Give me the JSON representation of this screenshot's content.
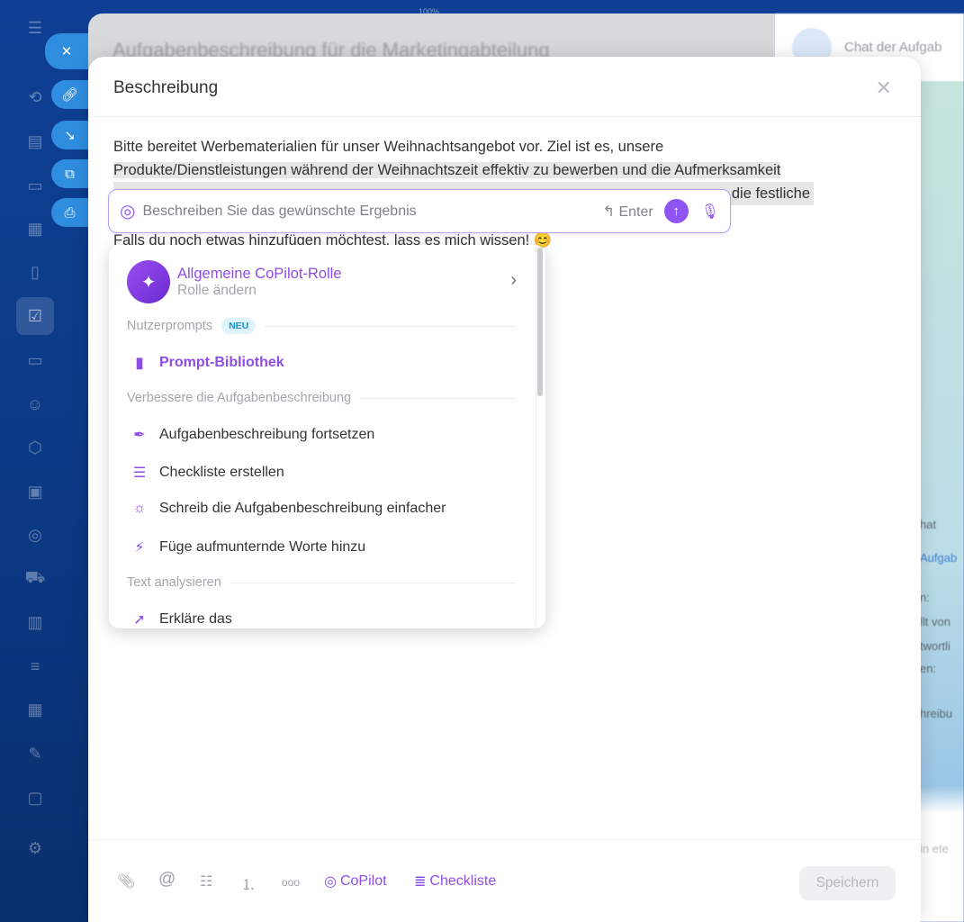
{
  "zoom_label": "100%",
  "background_task": {
    "title": "Aufgabenbeschreibung für die Marketingabteilung"
  },
  "chat": {
    "title": "Chat der Aufgab",
    "fragments": [
      "hat",
      "Aufgab",
      "n:",
      "llt von",
      "twortli",
      "en:",
      "hreibu",
      "in ete"
    ]
  },
  "modal": {
    "title": "Beschreibung",
    "close_icon": "close-icon",
    "body_lines": [
      "Bitte bereitet Werbematerialien für unser Weihnachtsangebot vor. Ziel ist es, unsere",
      "Produkte/Dienstleistungen während der Weihnachtszeit effektiv zu bewerben und die Aufmerksamkeit",
      "die festliche",
      "Falls du noch etwas hinzufügen möchtest, lass es mich wissen! 😊"
    ],
    "copilot_input": {
      "placeholder": "Beschreiben Sie das gewünschte Ergebnis",
      "enter_hint": "Enter"
    },
    "menu": {
      "role_name": "Allgemeine CoPilot-Rolle",
      "role_sub": "Rolle ändern",
      "sections": [
        {
          "title": "Nutzerprompts",
          "badge": "NEU",
          "items": [
            {
              "label": "Prompt-Bibliothek",
              "icon": "book-plus-icon"
            }
          ]
        },
        {
          "title": "Verbessere die Aufgabenbeschreibung",
          "items": [
            {
              "label": "Aufgabenbeschreibung fortsetzen",
              "icon": "pen-icon"
            },
            {
              "label": "Checkliste erstellen",
              "icon": "list-icon"
            },
            {
              "label": "Schreib die Aufgabenbeschreibung einfacher",
              "icon": "sun-icon"
            },
            {
              "label": "Füge aufmunternde Worte hinzu",
              "icon": "lightning-icon"
            }
          ]
        },
        {
          "title": "Text analysieren",
          "items": [
            {
              "label": "Erkläre das",
              "icon": "cursor-click-icon"
            }
          ]
        }
      ]
    },
    "footer": {
      "copilot_label": "CoPilot",
      "checklist_label": "Checkliste",
      "save_label": "Speichern"
    }
  },
  "colors": {
    "accent": "#8e4de6",
    "sidebar": "#0e3f94",
    "pill": "#2f8de0"
  }
}
